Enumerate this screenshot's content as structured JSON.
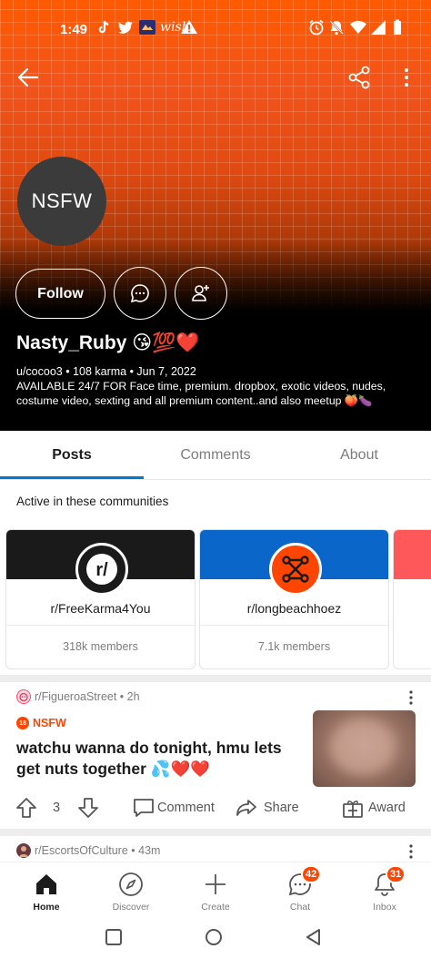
{
  "status_bar": {
    "time": "1:49",
    "wish_text": "wish"
  },
  "profile": {
    "avatar_text": "NSFW",
    "follow_label": "Follow",
    "username": "Nasty_Ruby",
    "username_emojis": "😘💯❤️",
    "meta": "u/cocoo3 • 108 karma • Jun 7, 2022",
    "bio": "AVAILABLE 24/7 FOR Face time, premium. dropbox, exotic videos, nudes, costume video, sexting and all premium content..and also meetup 🍑🍆"
  },
  "tabs": [
    {
      "label": "Posts",
      "active": true
    },
    {
      "label": "Comments",
      "active": false
    },
    {
      "label": "About",
      "active": false
    }
  ],
  "communities": {
    "title": "Active in these communities",
    "items": [
      {
        "name": "r/FreeKarma4You",
        "members": "318k members",
        "icon_text": "r/",
        "banner_color": "#1a1a1b",
        "icon_color": "#1a1a1b"
      },
      {
        "name": "r/longbeachhoez",
        "members": "7.1k members",
        "banner_color": "#0a66c9",
        "icon_color": "#ff4500"
      }
    ]
  },
  "post": {
    "subreddit": "r/FigueroaStreet",
    "age": "2h",
    "nsfw_label": "NSFW",
    "nsfw_badge": "18",
    "title": "watchu wanna do tonight, hmu lets get nuts together 💦❤️❤️",
    "score": "3",
    "comment_label": "Comment",
    "share_label": "Share",
    "award_label": "Award"
  },
  "post2": {
    "subreddit": "r/EscortsOfCulture",
    "age": "43m"
  },
  "bottom_nav": [
    {
      "label": "Home",
      "active": true
    },
    {
      "label": "Discover",
      "active": false
    },
    {
      "label": "Create",
      "active": false
    },
    {
      "label": "Chat",
      "active": false,
      "badge": "42"
    },
    {
      "label": "Inbox",
      "active": false,
      "badge": "31"
    }
  ],
  "colors": {
    "accent_blue": "#0079d3",
    "reddit_orange": "#ff4500"
  }
}
